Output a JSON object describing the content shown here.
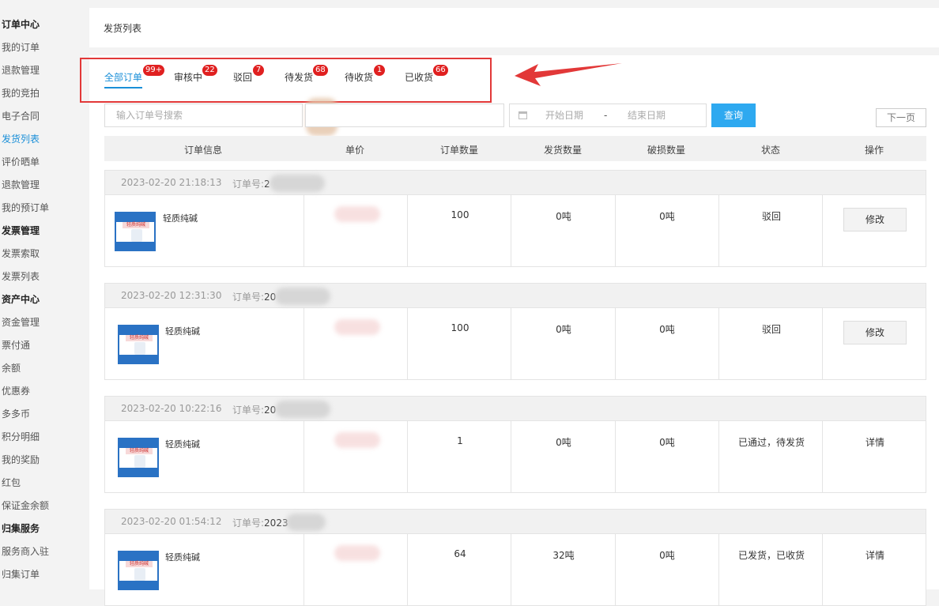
{
  "sidebar": {
    "items": [
      {
        "label": "订单中心",
        "group": true
      },
      {
        "label": "我的订单"
      },
      {
        "label": "退款管理"
      },
      {
        "label": "我的竞拍"
      },
      {
        "label": "电子合同"
      },
      {
        "label": "发货列表",
        "active": true
      },
      {
        "label": "评价晒单"
      },
      {
        "label": "退款管理"
      },
      {
        "label": "我的预订单"
      },
      {
        "label": "发票管理",
        "group": true
      },
      {
        "label": "发票索取"
      },
      {
        "label": "发票列表"
      },
      {
        "label": "资产中心",
        "group": true
      },
      {
        "label": "资金管理"
      },
      {
        "label": "票付通"
      },
      {
        "label": "余额"
      },
      {
        "label": "优惠券"
      },
      {
        "label": "多多币"
      },
      {
        "label": "积分明细"
      },
      {
        "label": "我的奖励"
      },
      {
        "label": "红包"
      },
      {
        "label": "保证金余额"
      },
      {
        "label": "归集服务",
        "group": true
      },
      {
        "label": "服务商入驻"
      },
      {
        "label": "归集订单"
      }
    ]
  },
  "header": {
    "title": "发货列表"
  },
  "tabs": [
    {
      "label": "全部订单",
      "badge": "99+",
      "active": true
    },
    {
      "label": "审核中",
      "badge": "22"
    },
    {
      "label": "驳回",
      "badge": "7"
    },
    {
      "label": "待发货",
      "badge": "68"
    },
    {
      "label": "待收货",
      "badge": "1"
    },
    {
      "label": "已收货",
      "badge": "66"
    }
  ],
  "filters": {
    "search_placeholder": "输入订单号搜索",
    "start_date_placeholder": "开始日期",
    "date_separator": "-",
    "end_date_placeholder": "结束日期",
    "query_label": "查询",
    "next_page_label": "下一页"
  },
  "table": {
    "columns": [
      "订单信息",
      "单价",
      "订单数量",
      "发货数量",
      "破损数量",
      "状态",
      "操作"
    ],
    "order_no_label": "订单号:",
    "orders": [
      {
        "time": "2023-02-20 21:18:13",
        "order_no_partial": "2",
        "product": "轻质纯碱",
        "quantity": "100",
        "shipped": "0吨",
        "damaged": "0吨",
        "status": "驳回",
        "action": "修改",
        "action_type": "button"
      },
      {
        "time": "2023-02-20 12:31:30",
        "order_no_partial": "20",
        "product": "轻质纯碱",
        "quantity": "100",
        "shipped": "0吨",
        "damaged": "0吨",
        "status": "驳回",
        "action": "修改",
        "action_type": "button"
      },
      {
        "time": "2023-02-20 10:22:16",
        "order_no_partial": "20",
        "product": "轻质纯碱",
        "quantity": "1",
        "shipped": "0吨",
        "damaged": "0吨",
        "status": "已通过，待发货",
        "action": "详情",
        "action_type": "link"
      },
      {
        "time": "2023-02-20 01:54:12",
        "order_no_partial": "2023",
        "product": "轻质纯碱",
        "quantity": "64",
        "shipped": "32吨",
        "damaged": "0吨",
        "status": "已发货，已收货",
        "action": "详情",
        "action_type": "link"
      }
    ]
  },
  "colors": {
    "accent": "#1a8fd8",
    "badge": "#e02020",
    "highlight": "#e23838",
    "query_button": "#2ea9f0"
  }
}
